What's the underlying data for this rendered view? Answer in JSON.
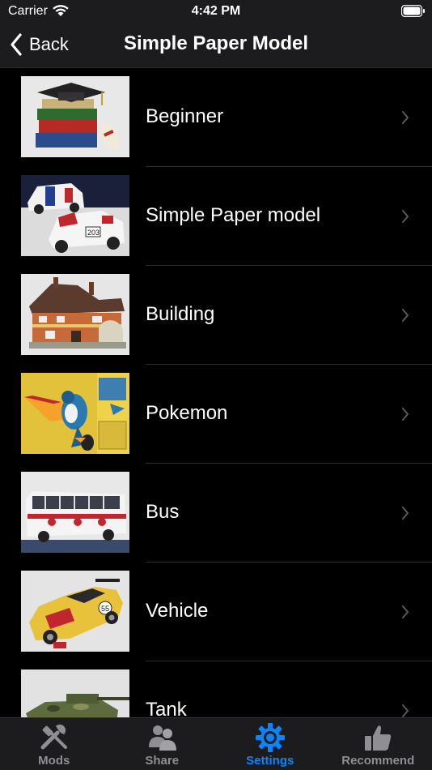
{
  "status_bar": {
    "carrier": "Carrier",
    "time": "4:42 PM"
  },
  "nav": {
    "back_label": "Back",
    "title": "Simple Paper Model"
  },
  "list": {
    "items": [
      {
        "label": "Beginner",
        "icon": "books-graduation-cap-thumbnail"
      },
      {
        "label": "Simple Paper model",
        "icon": "rally-cars-thumbnail"
      },
      {
        "label": "Building",
        "icon": "house-thumbnail"
      },
      {
        "label": "Pokemon",
        "icon": "toucan-pokemon-thumbnail"
      },
      {
        "label": "Bus",
        "icon": "bus-thumbnail"
      },
      {
        "label": "Vehicle",
        "icon": "race-car-thumbnail"
      },
      {
        "label": "Tank",
        "icon": "tank-thumbnail"
      }
    ]
  },
  "tab_bar": {
    "tabs": [
      {
        "label": "Mods",
        "icon": "tools-icon",
        "active": false
      },
      {
        "label": "Share",
        "icon": "users-icon",
        "active": false
      },
      {
        "label": "Settings",
        "icon": "gear-icon",
        "active": true
      },
      {
        "label": "Recommend",
        "icon": "thumbs-up-icon",
        "active": false
      }
    ]
  },
  "colors": {
    "background": "#000000",
    "bar_background": "#1c1c1e",
    "active_tab": "#0a84ff",
    "inactive_tab": "#8e8e93",
    "separator": "#2c2c2e"
  }
}
